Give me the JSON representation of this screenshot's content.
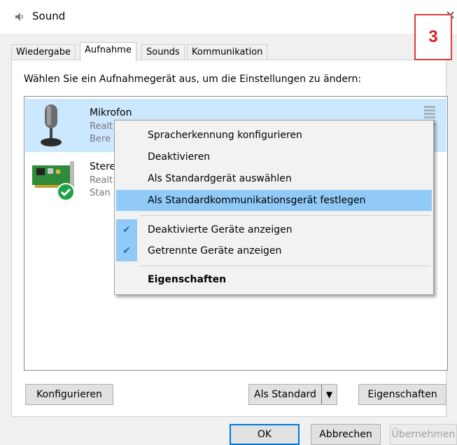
{
  "window": {
    "title": "Sound",
    "close_glyph": "×"
  },
  "step_badge": "3",
  "tabs": [
    {
      "label": "Wiedergabe"
    },
    {
      "label": "Aufnahme",
      "active": true
    },
    {
      "label": "Sounds"
    },
    {
      "label": "Kommunikation"
    }
  ],
  "instruction": "Wählen Sie ein Aufnahmegerät aus, um die Einstellungen zu ändern:",
  "devices": [
    {
      "name": "Mikrofon",
      "line1": "Realt",
      "line2": "Bere",
      "icon": "microphone-icon",
      "selected": true
    },
    {
      "name": "Stere",
      "line1": "Realt",
      "line2": "Stan",
      "icon": "sound-card-icon",
      "selected": false
    }
  ],
  "context_menu": {
    "items": [
      {
        "label": "Spracherkennung konfigurieren"
      },
      {
        "label": "Deaktivieren"
      },
      {
        "label": "Als Standardgerät auswählen"
      },
      {
        "label": "Als Standardkommunikationsgerät festlegen",
        "hovered": true
      },
      {
        "label": "Deaktivierte Geräte anzeigen",
        "checked": true
      },
      {
        "label": "Getrennte Geräte anzeigen",
        "checked": true
      },
      {
        "label": "Eigenschaften",
        "bold": true
      }
    ],
    "check_glyph": "✔"
  },
  "buttons": {
    "configure": "Konfigurieren",
    "set_default": "Als Standard",
    "set_default_arrow": "▼",
    "properties": "Eigenschaften",
    "ok": "OK",
    "cancel": "Abbrechen",
    "apply": "Übernehmen"
  },
  "colors": {
    "selection": "#cce8ff",
    "menu_hover": "#91c9f7",
    "badge_red": "#e03a3a",
    "check_green": "#1fa24a"
  }
}
